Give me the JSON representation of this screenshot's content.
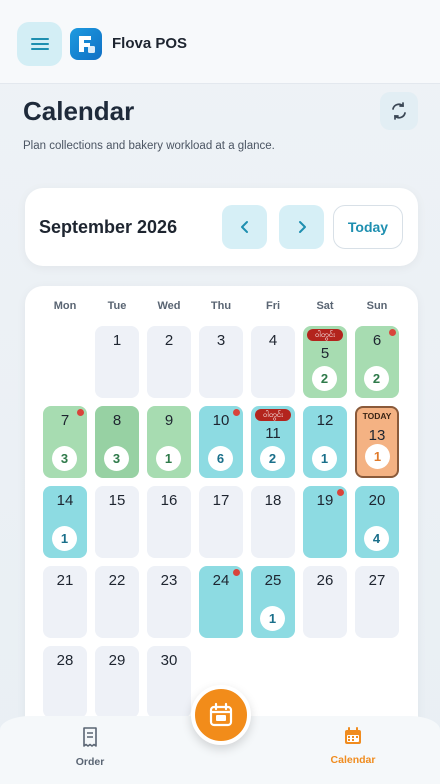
{
  "header": {
    "app_name": "Flova POS"
  },
  "page": {
    "title": "Calendar",
    "subtitle": "Plan collections and bakery workload at a glance."
  },
  "month": {
    "label": "September 2026",
    "today_label": "Today"
  },
  "weekdays": [
    "Mon",
    "Tue",
    "Wed",
    "Thu",
    "Fri",
    "Sat",
    "Sun"
  ],
  "days": [
    {
      "n": "1",
      "style": "plain"
    },
    {
      "n": "2",
      "style": "plain"
    },
    {
      "n": "3",
      "style": "plain"
    },
    {
      "n": "4",
      "style": "plain"
    },
    {
      "n": "5",
      "style": "green",
      "count": "2",
      "badge": "ဝါတွင်း"
    },
    {
      "n": "6",
      "style": "green",
      "count": "2",
      "dot": true
    },
    {
      "n": "7",
      "style": "green",
      "count": "3",
      "dot": true
    },
    {
      "n": "8",
      "style": "green-dark",
      "count": "3"
    },
    {
      "n": "9",
      "style": "green",
      "count": "1"
    },
    {
      "n": "10",
      "style": "teal",
      "count": "6",
      "dot": true
    },
    {
      "n": "11",
      "style": "teal",
      "count": "2",
      "badge": "ဝါတွင်း"
    },
    {
      "n": "12",
      "style": "teal",
      "count": "1"
    },
    {
      "n": "13",
      "style": "today",
      "count": "1",
      "tag": "TODAY"
    },
    {
      "n": "14",
      "style": "teal",
      "count": "1"
    },
    {
      "n": "15",
      "style": "plain"
    },
    {
      "n": "16",
      "style": "plain"
    },
    {
      "n": "17",
      "style": "plain"
    },
    {
      "n": "18",
      "style": "plain"
    },
    {
      "n": "19",
      "style": "teal",
      "dot": true
    },
    {
      "n": "20",
      "style": "teal",
      "count": "4"
    },
    {
      "n": "21",
      "style": "plain"
    },
    {
      "n": "22",
      "style": "plain"
    },
    {
      "n": "23",
      "style": "plain"
    },
    {
      "n": "24",
      "style": "teal",
      "dot": true
    },
    {
      "n": "25",
      "style": "teal",
      "count": "1"
    },
    {
      "n": "26",
      "style": "plain"
    },
    {
      "n": "27",
      "style": "plain"
    },
    {
      "n": "28",
      "style": "plain"
    },
    {
      "n": "29",
      "style": "plain"
    },
    {
      "n": "30",
      "style": "plain"
    }
  ],
  "bottom_nav": {
    "order_label": "Order",
    "calendar_label": "Calendar"
  },
  "colors": {
    "accent": "#f28c1a",
    "teal": "#8ddbe2",
    "green": "#a7dcb1",
    "primary": "#1e8fb0"
  }
}
